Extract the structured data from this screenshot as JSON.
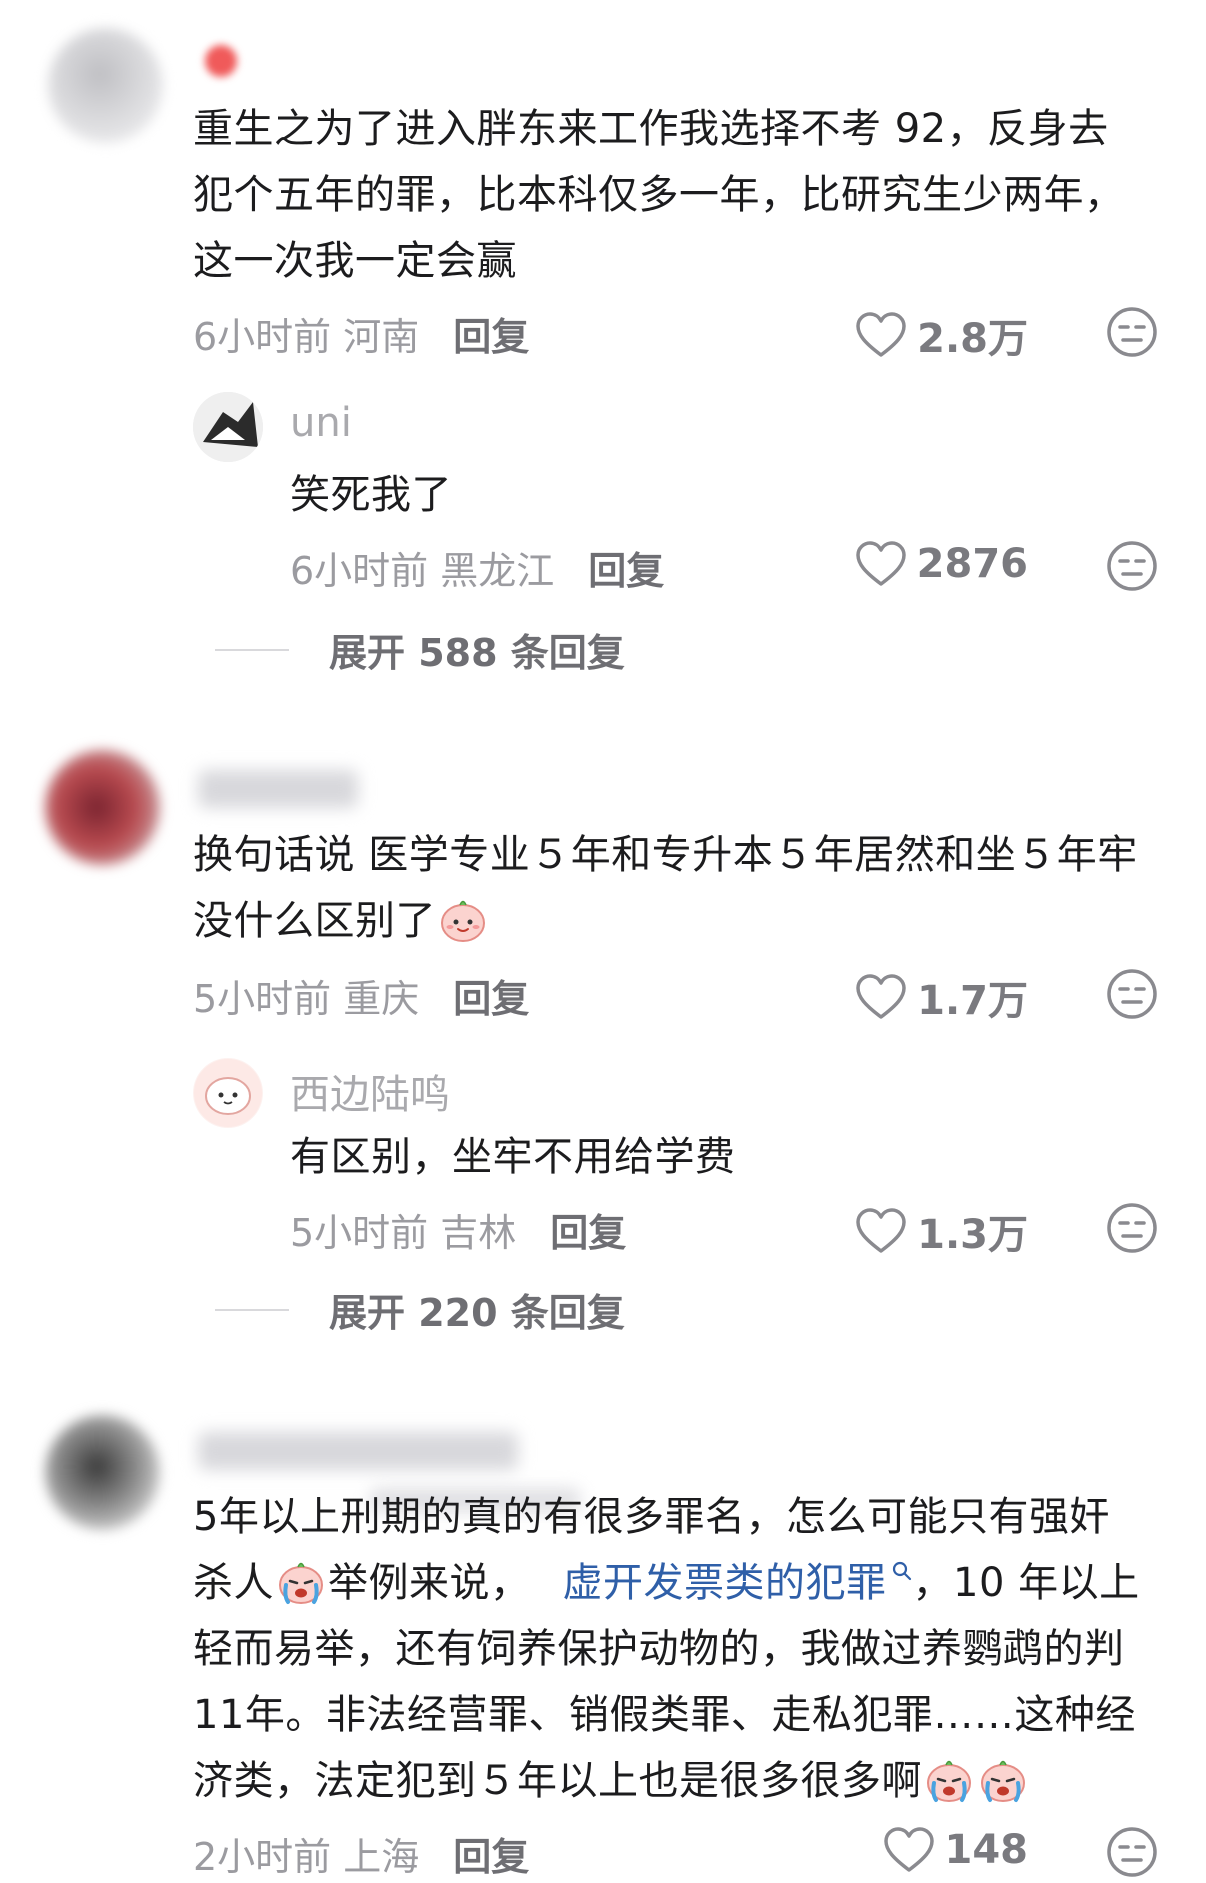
{
  "comments": [
    {
      "text": "重生之为了进入胖东来工作我选择不考 92，反身去犯个五年的罪，比本科仅多一年，比研究生少两年，这一次我一定会赢",
      "time": "6小时前",
      "location": "河南",
      "reply_label": "回复",
      "likes": "2.8万",
      "reply": {
        "username": "uni",
        "text": "笑死我了",
        "time": "6小时前",
        "location": "黑龙江",
        "reply_label": "回复",
        "likes": "2876"
      },
      "expand_label": "展开 588 条回复"
    },
    {
      "text_before_emoji": "换句话说 医学专业５年和专升本５年居然和坐５年牢没什么区别了",
      "emoji": "cute-face-emoji",
      "time": "5小时前",
      "location": "重庆",
      "reply_label": "回复",
      "likes": "1.7万",
      "reply": {
        "username": "西边陆鸣",
        "text": "有区别，坐牢不用给学费",
        "time": "5小时前",
        "location": "吉林",
        "reply_label": "回复",
        "likes": "1.3万"
      },
      "expand_label": "展开 220 条回复"
    },
    {
      "line1": "5年以上刑期的真的有很多罪名，怎么可能只有强奸",
      "line2_a": "杀人",
      "line2_b": "举例来说，",
      "line2_link": "虚开发票类的犯罪",
      "line2_c": "，10 年以上",
      "line3": "轻而易举，还有饲养保护动物的，我做过养鹦鹉的判",
      "line4": "11年。非法经营罪、销假类罪、走私犯罪……这种经",
      "line5": "济类，法定犯到５年以上也是很多很多啊",
      "time": "2小时前",
      "location": "上海",
      "reply_label": "回复",
      "likes": "148"
    }
  ],
  "icons": {
    "like": "heart-outline-icon",
    "dislike": "meh-face-icon",
    "search_hint": "search-icon"
  },
  "colors": {
    "link": "#2f5fa8",
    "meta": "#9b9ba0",
    "text": "#1c1c1e"
  }
}
